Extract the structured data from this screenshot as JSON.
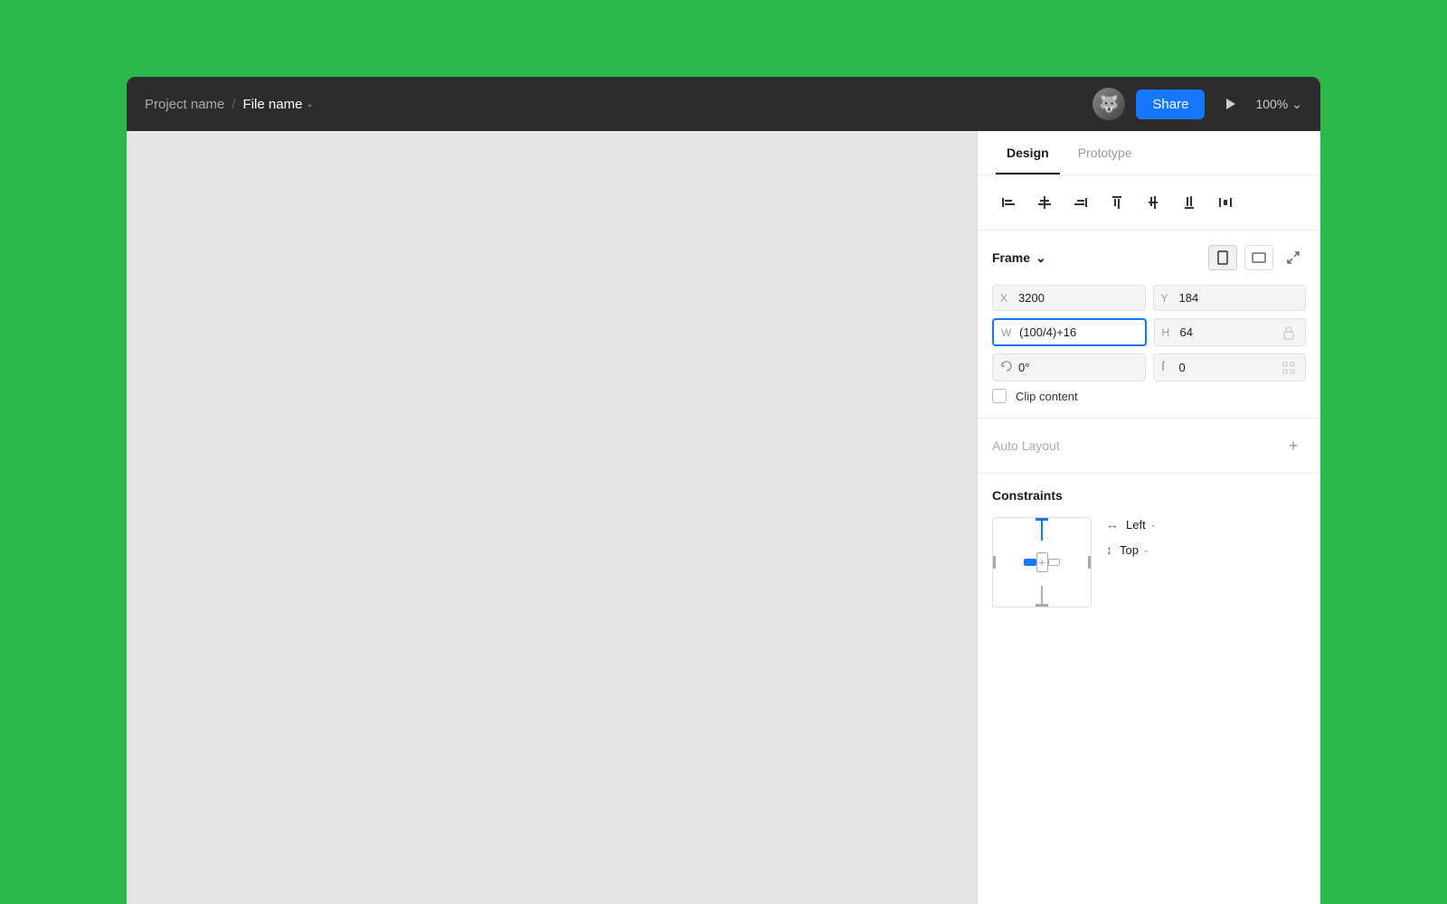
{
  "header": {
    "project_name": "Project name",
    "separator": "/",
    "file_name": "File name",
    "share_label": "Share",
    "zoom_level": "100%",
    "play_icon": "▶",
    "chevron_down": "⌄"
  },
  "panel": {
    "tabs": [
      {
        "label": "Design",
        "active": true
      },
      {
        "label": "Prototype",
        "active": false
      }
    ],
    "alignment": {
      "buttons": [
        {
          "icon": "align-left",
          "unicode": "⊢"
        },
        {
          "icon": "align-center-v",
          "unicode": "⊟"
        },
        {
          "icon": "align-right",
          "unicode": "⊣"
        },
        {
          "icon": "align-top",
          "unicode": "⊤"
        },
        {
          "icon": "align-center-h",
          "unicode": "⊞"
        },
        {
          "icon": "align-bottom",
          "unicode": "⊥"
        },
        {
          "icon": "distribute",
          "unicode": "⠿"
        }
      ]
    },
    "frame": {
      "title": "Frame",
      "x_label": "X",
      "x_value": "3200",
      "y_label": "Y",
      "y_value": "184",
      "w_label": "W",
      "w_value": "(100/4)+16",
      "h_label": "H",
      "h_value": "64",
      "rotation_label": "↺",
      "rotation_value": "0°",
      "radius_value": "0",
      "clip_content": "Clip content",
      "portrait_icon": "▭",
      "landscape_icon": "▬",
      "collapse_icon": "↙↗"
    },
    "auto_layout": {
      "title": "Auto Layout",
      "add_icon": "+"
    },
    "constraints": {
      "title": "Constraints",
      "horizontal_label": "Left",
      "vertical_label": "Top",
      "h_arrow": "↔",
      "v_arrow": "↕"
    }
  }
}
